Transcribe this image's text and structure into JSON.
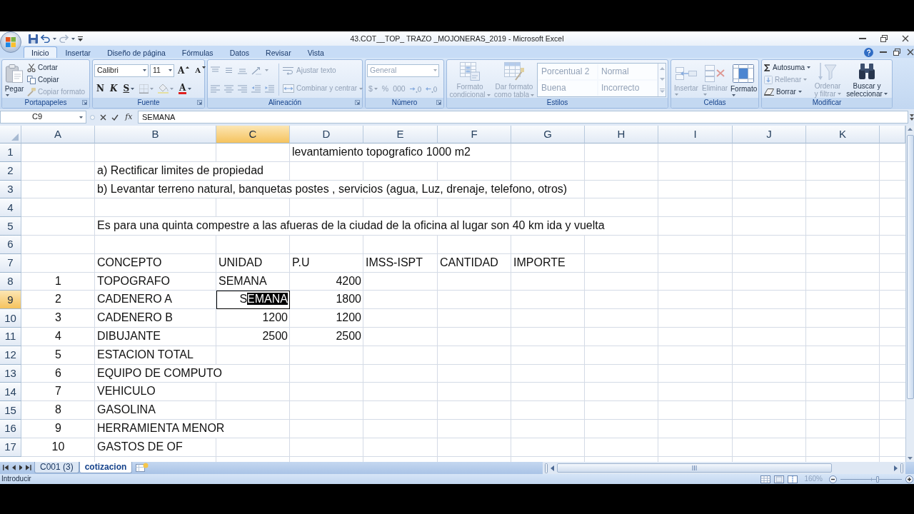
{
  "window": {
    "title": "43.COT__TOP_ TRAZO _MOJONERAS_2019 - Microsoft Excel"
  },
  "ribbon_tabs": [
    {
      "label": "Inicio",
      "selected": true
    },
    {
      "label": "Insertar",
      "selected": false
    },
    {
      "label": "Diseño de página",
      "selected": false
    },
    {
      "label": "Fórmulas",
      "selected": false
    },
    {
      "label": "Datos",
      "selected": false
    },
    {
      "label": "Revisar",
      "selected": false
    },
    {
      "label": "Vista",
      "selected": false
    }
  ],
  "clipboard_group": {
    "title": "Portapapeles",
    "paste": {
      "label": "Pegar",
      "disabled": false
    },
    "cut": {
      "label": "Cortar",
      "disabled": false
    },
    "copy": {
      "label": "Copiar",
      "disabled": false
    },
    "format_painter": {
      "label": "Copiar formato",
      "disabled": true
    }
  },
  "font_group": {
    "title": "Fuente",
    "font_name": "Calibri",
    "font_size": "11",
    "grow_font": "A",
    "shrink_font": "A",
    "bold": "N",
    "italic": "K",
    "underline": "S",
    "borders": {
      "disabled": true
    },
    "fill_color": {
      "disabled": true
    },
    "font_color": {
      "label": "A",
      "disabled": false
    }
  },
  "alignment_group": {
    "title": "Alineación",
    "disabled": true,
    "wrap_text": "Ajustar texto",
    "merge_center": "Combinar y centrar"
  },
  "number_group": {
    "title": "Número",
    "disabled": true,
    "format": "General",
    "currency": "$",
    "percent": "%",
    "thousands": "000"
  },
  "styles_group": {
    "title": "Estilos",
    "disabled": true,
    "conditional_format": "Formato condicional",
    "format_as_table": "Dar formato como tabla",
    "cell_styles": [
      "Porcentual 2",
      "Normal",
      "Buena",
      "Incorrecto"
    ]
  },
  "cells_group": {
    "title": "Celdas",
    "insert": {
      "label": "Insertar",
      "disabled": true
    },
    "delete": {
      "label": "Eliminar",
      "disabled": true
    },
    "format": {
      "label": "Formato",
      "disabled": false
    }
  },
  "editing_group": {
    "title": "Modificar",
    "autosum": {
      "label": "Autosuma",
      "disabled": false
    },
    "fill": {
      "label": "Rellenar",
      "disabled": true
    },
    "clear": {
      "label": "Borrar",
      "disabled": false
    },
    "sort_filter": {
      "label": "Ordenar y filtrar",
      "disabled": true
    },
    "find_select": {
      "label": "Buscar y seleccionar",
      "disabled": false
    }
  },
  "formula_bar": {
    "name_box": "C9",
    "function_button": "fx",
    "formula": "SEMANA"
  },
  "sheet": {
    "columns": [
      {
        "label": "A",
        "selected": false
      },
      {
        "label": "B",
        "selected": false
      },
      {
        "label": "C",
        "selected": true
      },
      {
        "label": "D",
        "selected": false
      },
      {
        "label": "E",
        "selected": false
      },
      {
        "label": "F",
        "selected": false
      },
      {
        "label": "G",
        "selected": false
      },
      {
        "label": "H",
        "selected": false
      },
      {
        "label": "I",
        "selected": false
      },
      {
        "label": "J",
        "selected": false
      },
      {
        "label": "K",
        "selected": false
      }
    ],
    "rows": [
      {
        "number": "1",
        "selected": false,
        "D": {
          "kind": "text",
          "text": "levantamiento topografico 1000 m2"
        }
      },
      {
        "number": "2",
        "selected": false,
        "B": {
          "kind": "text",
          "text": "a) Rectificar limites de propiedad"
        }
      },
      {
        "number": "3",
        "selected": false,
        "B": {
          "kind": "text",
          "text": "b) Levantar terreno natural, banquetas postes , servicios (agua, Luz, drenaje, telefono, otros)"
        }
      },
      {
        "number": "4",
        "selected": false
      },
      {
        "number": "5",
        "selected": false,
        "B": {
          "kind": "text",
          "text": "Es para una quinta compestre a las afueras de la ciudad de la oficina al lugar son 40 km ida y vuelta"
        }
      },
      {
        "number": "6",
        "selected": false
      },
      {
        "number": "7",
        "selected": false,
        "B": {
          "kind": "text",
          "text": "CONCEPTO"
        },
        "C": {
          "kind": "text",
          "text": "UNIDAD"
        },
        "D": {
          "kind": "text",
          "text": "P.U"
        },
        "E": {
          "kind": "text",
          "text": "IMSS-ISPT"
        },
        "F": {
          "kind": "text",
          "text": "CANTIDAD"
        },
        "G": {
          "kind": "text",
          "text": "IMPORTE"
        }
      },
      {
        "number": "8",
        "selected": false,
        "A": {
          "kind": "centered",
          "text": "1"
        },
        "B": {
          "kind": "text",
          "text": "TOPOGRAFO"
        },
        "C": {
          "kind": "text",
          "text": "SEMANA"
        },
        "D": {
          "kind": "number",
          "text": "4200"
        }
      },
      {
        "number": "9",
        "selected": true,
        "A": {
          "kind": "centered",
          "text": "2"
        },
        "B": {
          "kind": "text",
          "text": "CADENERO A"
        },
        "C": {
          "kind": "editing",
          "text": "S",
          "selected_text": "EMANA"
        },
        "D": {
          "kind": "number",
          "text": "1800"
        }
      },
      {
        "number": "10",
        "selected": false,
        "A": {
          "kind": "centered",
          "text": "3"
        },
        "B": {
          "kind": "text",
          "text": "CADENERO B"
        },
        "C": {
          "kind": "number",
          "text": "1200"
        },
        "D": {
          "kind": "number",
          "text": "1200"
        }
      },
      {
        "number": "11",
        "selected": false,
        "A": {
          "kind": "centered",
          "text": "4"
        },
        "B": {
          "kind": "text",
          "text": "DIBUJANTE"
        },
        "C": {
          "kind": "number",
          "text": "2500"
        },
        "D": {
          "kind": "number",
          "text": "2500"
        }
      },
      {
        "number": "12",
        "selected": false,
        "A": {
          "kind": "centered",
          "text": "5"
        },
        "B": {
          "kind": "text",
          "text": "ESTACION TOTAL"
        }
      },
      {
        "number": "13",
        "selected": false,
        "A": {
          "kind": "centered",
          "text": "6"
        },
        "B": {
          "kind": "text",
          "text": "EQUIPO DE COMPUTO"
        }
      },
      {
        "number": "14",
        "selected": false,
        "A": {
          "kind": "centered",
          "text": "7"
        },
        "B": {
          "kind": "text",
          "text": "VEHICULO"
        }
      },
      {
        "number": "15",
        "selected": false,
        "A": {
          "kind": "centered",
          "text": "8"
        },
        "B": {
          "kind": "text",
          "text": "GASOLINA"
        }
      },
      {
        "number": "16",
        "selected": false,
        "A": {
          "kind": "centered",
          "text": "9"
        },
        "B": {
          "kind": "text",
          "text": "HERRAMIENTA MENOR"
        }
      },
      {
        "number": "17",
        "selected": false,
        "A": {
          "kind": "centered",
          "text": "10"
        },
        "B": {
          "kind": "text",
          "text": "GASTOS DE OF"
        }
      }
    ]
  },
  "sheet_tabs": [
    {
      "label": "C001 (3)",
      "selected": false
    },
    {
      "label": "cotizacion",
      "selected": true
    }
  ],
  "status_bar": {
    "mode": "Introducir",
    "zoom": "160%",
    "zoom_slider": {
      "level": 0.6
    }
  }
}
